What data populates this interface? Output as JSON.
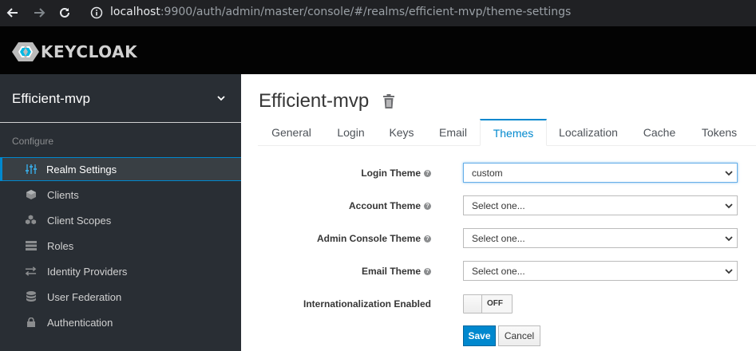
{
  "browser": {
    "url_host": "localhost",
    "url_rest": ":9900/auth/admin/master/console/#/realms/efficient-mvp/theme-settings"
  },
  "header": {
    "logo_text": "KEYCLOAK"
  },
  "sidebar": {
    "realm_name": "Efficient-mvp",
    "section_label": "Configure",
    "items": [
      {
        "label": "Realm Settings",
        "icon": "sliders-icon",
        "active": true
      },
      {
        "label": "Clients",
        "icon": "cube-icon"
      },
      {
        "label": "Client Scopes",
        "icon": "cubes-icon"
      },
      {
        "label": "Roles",
        "icon": "list-icon"
      },
      {
        "label": "Identity Providers",
        "icon": "exchange-icon"
      },
      {
        "label": "User Federation",
        "icon": "database-icon"
      },
      {
        "label": "Authentication",
        "icon": "lock-icon"
      }
    ]
  },
  "main": {
    "title": "Efficient-mvp",
    "tabs": [
      {
        "label": "General"
      },
      {
        "label": "Login"
      },
      {
        "label": "Keys"
      },
      {
        "label": "Email"
      },
      {
        "label": "Themes",
        "active": true
      },
      {
        "label": "Localization"
      },
      {
        "label": "Cache"
      },
      {
        "label": "Tokens"
      }
    ],
    "form": {
      "login_theme_label": "Login Theme",
      "login_theme_value": "custom",
      "account_theme_label": "Account Theme",
      "account_theme_value": "Select one...",
      "admin_theme_label": "Admin Console Theme",
      "admin_theme_value": "Select one...",
      "email_theme_label": "Email Theme",
      "email_theme_value": "Select one...",
      "i18n_label": "Internationalization Enabled",
      "i18n_value": "OFF",
      "save_label": "Save",
      "cancel_label": "Cancel"
    }
  },
  "colors": {
    "accent": "#0088ce",
    "sidebar_bg": "#292e34",
    "header_bg": "#030303"
  }
}
